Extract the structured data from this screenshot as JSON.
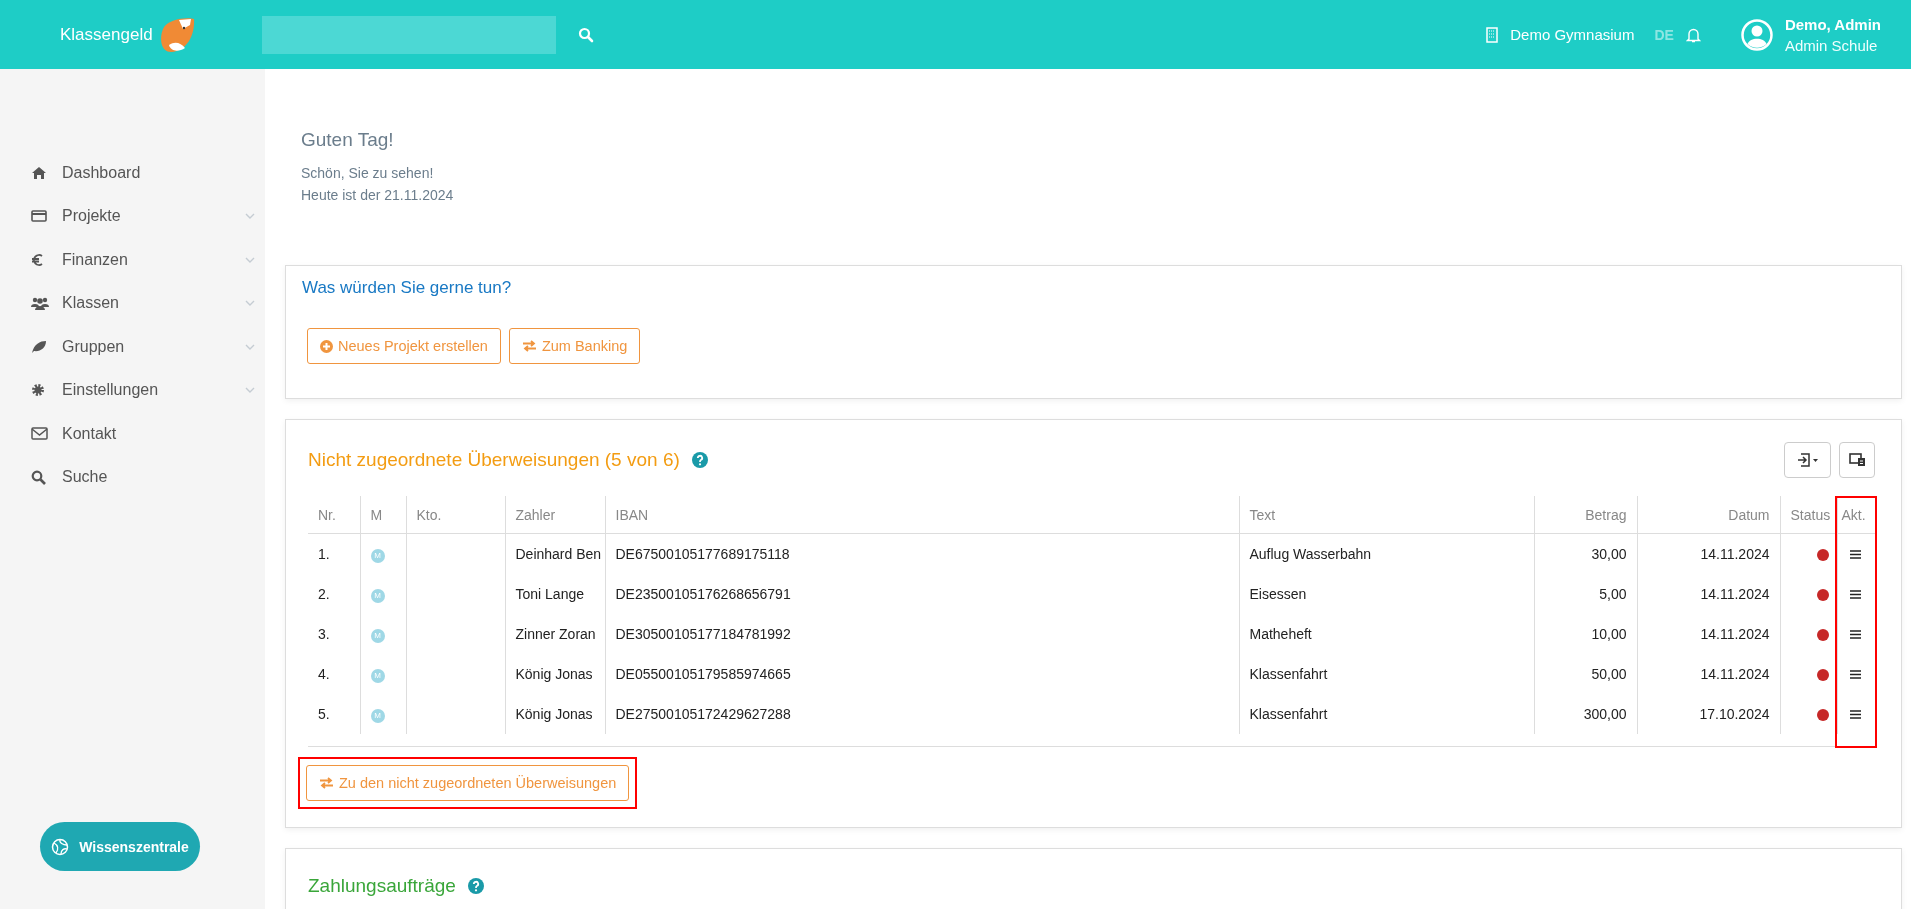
{
  "header": {
    "brand": "Klassengeld",
    "school": "Demo Gymnasium",
    "language": {
      "label": "DE",
      "selected": true
    },
    "user": {
      "name": "Demo, Admin",
      "role": "Admin Schule"
    }
  },
  "sidebar": {
    "items": [
      {
        "label": "Dashboard",
        "expandable": false
      },
      {
        "label": "Projekte",
        "expandable": true
      },
      {
        "label": "Finanzen",
        "expandable": true
      },
      {
        "label": "Klassen",
        "expandable": true
      },
      {
        "label": "Gruppen",
        "expandable": true
      },
      {
        "label": "Einstellungen",
        "expandable": true
      },
      {
        "label": "Kontakt",
        "expandable": false
      },
      {
        "label": "Suche",
        "expandable": false
      }
    ],
    "help_button": "Wissenszentrale"
  },
  "greeting": {
    "title": "Guten Tag!",
    "lines": [
      "Schön, Sie zu sehen!",
      "Heute ist der 21.11.2024"
    ]
  },
  "quick_actions": {
    "title": "Was würden Sie gerne tun?",
    "buttons": [
      {
        "label": "Neues Projekt erstellen",
        "kind": "plus"
      },
      {
        "label": "Zum Banking",
        "kind": "transfer"
      }
    ]
  },
  "unassigned": {
    "title": "Nicht zugeordnete Überweisungen (5 von 6)",
    "table": {
      "columns": [
        {
          "label": "Nr.",
          "highlighted": false
        },
        {
          "label": "M",
          "highlighted": false
        },
        {
          "label": "Kto.",
          "highlighted": false
        },
        {
          "label": "Zahler",
          "highlighted": false
        },
        {
          "label": "IBAN",
          "highlighted": false
        },
        {
          "label": "Text",
          "highlighted": false
        },
        {
          "label": "Betrag",
          "highlighted": false
        },
        {
          "label": "Datum",
          "highlighted": false
        },
        {
          "label": "Status",
          "highlighted": false
        },
        {
          "label": "Akt.",
          "highlighted": true
        }
      ],
      "rows": [
        {
          "nr": "1.",
          "badge": "M",
          "payer": "Deinhard Ben",
          "iban": "DE67500105177689175118",
          "text": "Auflug Wasserbahn",
          "amount": "30,00",
          "date": "14.11.2024",
          "color": "#c62828"
        },
        {
          "nr": "2.",
          "badge": "M",
          "payer": "Toni Lange",
          "iban": "DE23500105176268656791",
          "text": "Eisessen",
          "amount": "5,00",
          "date": "14.11.2024",
          "color": "#c62828"
        },
        {
          "nr": "3.",
          "badge": "M",
          "payer": "Zinner Zoran",
          "iban": "DE30500105177184781992",
          "text": "Matheheft",
          "amount": "10,00",
          "date": "14.11.2024",
          "color": "#c62828"
        },
        {
          "nr": "4.",
          "badge": "M",
          "payer": "König Jonas",
          "iban": "DE05500105179585974665",
          "text": "Klassenfahrt",
          "amount": "50,00",
          "date": "14.11.2024",
          "color": "#c62828"
        },
        {
          "nr": "5.",
          "badge": "M",
          "payer": "König Jonas",
          "iban": "DE27500105172429627288",
          "text": "Klassenfahrt",
          "amount": "300,00",
          "date": "17.10.2024",
          "color": "#c62828"
        }
      ]
    },
    "footer_button": {
      "label": "Zu den nicht zugeordneten Überweisungen",
      "highlighted": true
    }
  },
  "payment_orders": {
    "title": "Zahlungsaufträge"
  }
}
